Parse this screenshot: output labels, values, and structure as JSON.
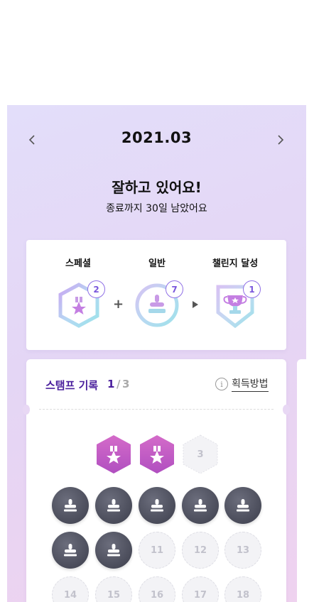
{
  "month": {
    "title": "2021.03",
    "prev_icon": "chevron-left-icon",
    "next_icon": "chevron-right-icon"
  },
  "headline": "잘하고 있어요!",
  "subline": "종료까지 30일 남았어요",
  "summary": {
    "special": {
      "label": "스페셜",
      "count": "2",
      "icon": "special-medal-hexagon-icon"
    },
    "plus_symbol": "+",
    "normal": {
      "label": "일반",
      "count": "7",
      "icon": "stamp-circle-icon"
    },
    "arrow_icon": "play-arrow-icon",
    "challenge": {
      "label": "챌린지 달성",
      "count": "1",
      "icon": "trophy-shield-icon"
    }
  },
  "record": {
    "title": "스탬프 기록",
    "current_page": "1",
    "separator": "/",
    "total_pages": "3",
    "how_label": "획득방법",
    "info_icon_text": "i"
  },
  "stamps": {
    "special_row": [
      {
        "state": "filled",
        "label": ""
      },
      {
        "state": "filled",
        "label": ""
      },
      {
        "state": "empty",
        "label": "3"
      }
    ],
    "row2": [
      {
        "state": "filled",
        "label": ""
      },
      {
        "state": "filled",
        "label": ""
      },
      {
        "state": "filled",
        "label": ""
      },
      {
        "state": "filled",
        "label": ""
      },
      {
        "state": "filled",
        "label": ""
      }
    ],
    "row3": [
      {
        "state": "filled",
        "label": ""
      },
      {
        "state": "filled",
        "label": ""
      },
      {
        "state": "empty",
        "label": "11"
      },
      {
        "state": "empty",
        "label": "12"
      },
      {
        "state": "empty",
        "label": "13"
      }
    ],
    "row4": [
      {
        "state": "empty",
        "label": "14"
      },
      {
        "state": "empty",
        "label": "15"
      },
      {
        "state": "empty",
        "label": "16"
      },
      {
        "state": "empty",
        "label": "17"
      },
      {
        "state": "empty",
        "label": "18"
      }
    ]
  },
  "colors": {
    "accent": "#4a1f9d",
    "badge": "#7a57dc",
    "special_stamp": "#c75bc4",
    "normal_stamp": "#4a4c5a",
    "empty_stamp": "#f3f3f6"
  }
}
